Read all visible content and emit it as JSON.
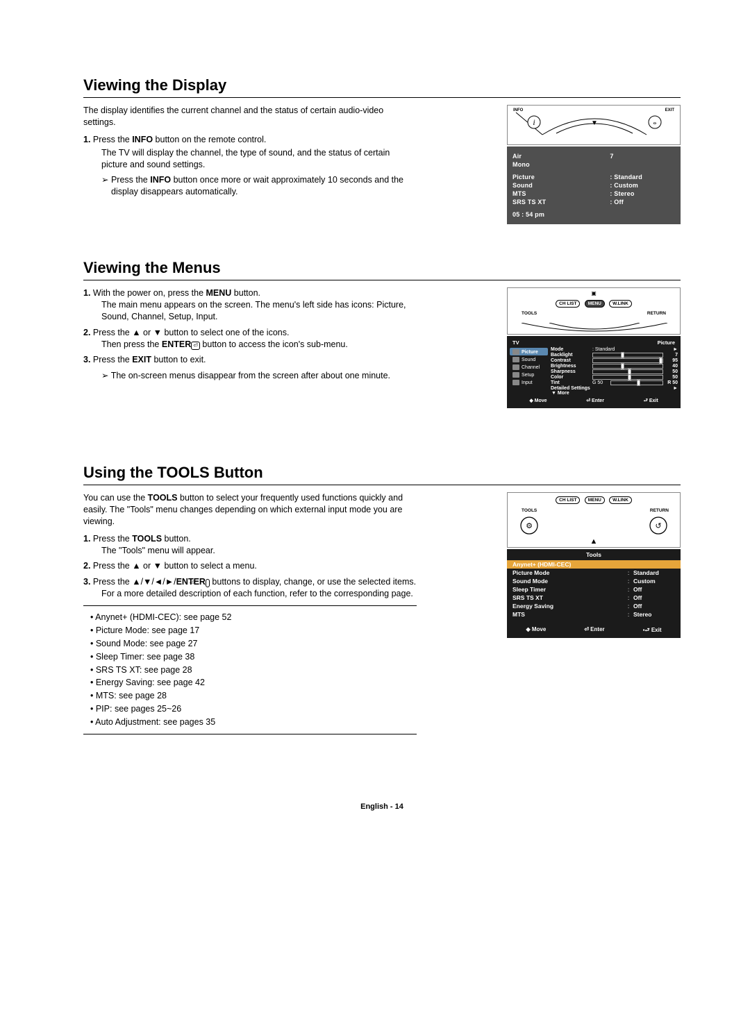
{
  "sections": {
    "viewing_display": {
      "title": "Viewing the Display",
      "intro": "The display identifies the current channel and the status of certain audio-video settings.",
      "step1_num": "1.",
      "step1_a": "Press the ",
      "step1_b": "INFO",
      "step1_c": " button on the remote control.",
      "step1_d": "The TV will display the channel, the type of sound, and the status of certain picture and sound settings.",
      "note_prefix": "➢  Press the ",
      "note_b": "INFO",
      "note_c": " button once more or wait approximately 10 seconds and the display disappears automatically."
    },
    "viewing_menus": {
      "title": "Viewing the Menus",
      "step1_num": "1.",
      "step1_a": "With the power on, press the ",
      "step1_b": "MENU",
      "step1_c": " button.",
      "step1_d": "The main menu appears on the screen. The menu's left side has icons: Picture, Sound, Channel, Setup, Input.",
      "step2_num": "2.",
      "step2_a": "Press the ▲ or ▼ button to select one of the icons.",
      "step2_b": "Then press the ",
      "step2_c": "ENTER",
      "step2_d": " button to access the icon's sub-menu.",
      "step3_num": "3.",
      "step3_a": "Press the ",
      "step3_b": "EXIT",
      "step3_c": " button to exit.",
      "note": "➢ The on-screen menus disappear from the screen after about one minute."
    },
    "using_tools": {
      "title": "Using the TOOLS Button",
      "intro_a": "You can use the ",
      "intro_b": "TOOLS",
      "intro_c": " button to select your frequently used functions quickly and easily. The \"Tools\" menu changes depending on which external input mode you are viewing.",
      "step1_num": "1.",
      "step1_a": "Press the ",
      "step1_b": "TOOLS",
      "step1_c": " button.",
      "step1_d": "The \"Tools\" menu will appear.",
      "step2_num": "2.",
      "step2_a": "Press the ▲ or ▼ button to select a menu.",
      "step3_num": "3.",
      "step3_a": "Press the ▲/▼/◄/►/",
      "step3_b": "ENTER",
      "step3_c": " buttons to display, change, or use the selected items. For a more detailed description of each function, refer to the corresponding page.",
      "bullets": [
        "• Anynet+ (HDMI-CEC): see page 52",
        "• Picture Mode: see page 17",
        "• Sound Mode: see page 27",
        "• Sleep Timer: see page 38",
        "• SRS TS XT: see page 28",
        "• Energy Saving: see page 42",
        "• MTS: see page 28",
        "• PIP: see pages 25~26",
        "• Auto Adjustment: see pages 35"
      ]
    }
  },
  "osd": {
    "info_panel": {
      "air_label": "Air",
      "air_val": "7",
      "mono": "Mono",
      "rows": [
        {
          "l": "Picture",
          "r": ": Standard"
        },
        {
          "l": "Sound",
          "r": ": Custom"
        },
        {
          "l": "MTS",
          "r": ": Stereo"
        },
        {
          "l": "SRS TS XT",
          "r": ": Off"
        }
      ],
      "time": "05 : 54 pm"
    },
    "remote1": {
      "info": "INFO",
      "exit": "EXIT"
    },
    "remote2": {
      "chlist": "CH LIST",
      "menu": "MENU",
      "wlink": "W.LINK",
      "tools": "TOOLS",
      "return": "RETURN"
    },
    "menu_panel": {
      "hl": "TV",
      "hr": "Picture",
      "side": [
        "Picture",
        "Sound",
        "Channel",
        "Setup",
        "Input"
      ],
      "rows": [
        {
          "l": "Mode",
          "txt": ": Standard",
          "slider": false,
          "arrow": "►"
        },
        {
          "l": "Backlight",
          "slider": true,
          "pos": 40,
          "num": "7"
        },
        {
          "l": "Contrast",
          "slider": true,
          "pos": 95,
          "num": "95"
        },
        {
          "l": "Brightness",
          "slider": true,
          "pos": 40,
          "num": "40"
        },
        {
          "l": "Sharpness",
          "slider": true,
          "pos": 50,
          "num": "50"
        },
        {
          "l": "Color",
          "slider": true,
          "pos": 50,
          "num": "50"
        },
        {
          "l": "Tint",
          "pretxt": "G 50",
          "slider": true,
          "pos": 50,
          "num": "R 50"
        },
        {
          "l": "Detailed Settings",
          "slider": false,
          "arrow": "►"
        }
      ],
      "more": "▼ More",
      "footer": [
        "◆ Move",
        "⏎ Enter",
        "⮐ Exit"
      ]
    },
    "tools_panel": {
      "title": "Tools",
      "hl": "Anynet+ (HDMI-CEC)",
      "rows": [
        {
          "l": "Picture Mode",
          ":": ":",
          "r": "Standard"
        },
        {
          "l": "Sound Mode",
          ":": ":",
          "r": "Custom"
        },
        {
          "l": "Sleep Timer",
          ":": ":",
          "r": "Off"
        },
        {
          "l": "SRS TS XT",
          ":": ":",
          "r": "Off"
        },
        {
          "l": "Energy Saving",
          ":": ":",
          "r": "Off"
        },
        {
          "l": "MTS",
          ":": ":",
          "r": "Stereo"
        }
      ],
      "footer": [
        "◆ Move",
        "⏎ Enter",
        "▪⮐ Exit"
      ]
    }
  },
  "footer": "English - 14"
}
